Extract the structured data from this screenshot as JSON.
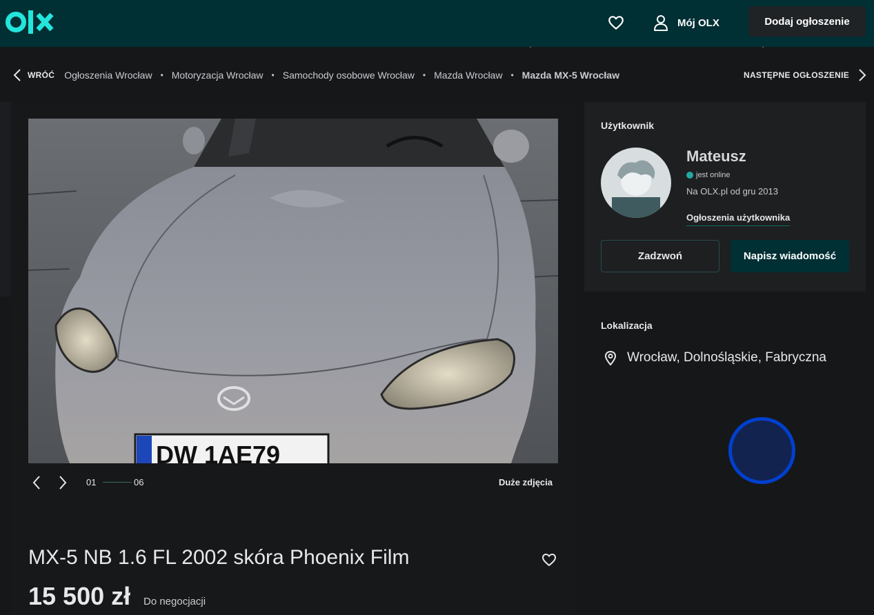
{
  "header": {
    "logo": "olx",
    "favorites_icon": "heart-icon",
    "account_icon": "user-icon",
    "account_label": "Mój OLX",
    "add_ad_label": "Dodaj ogłoszenie"
  },
  "breadcrumb": {
    "back_label": "WRÓĆ",
    "items": [
      "Ogłoszenia Wrocław",
      "Motoryzacja Wrocław",
      "Samochody osobowe Wrocław",
      "Mazda Wrocław",
      "Mazda MX-5 Wrocław"
    ],
    "separator": "•",
    "next_label": "NASTĘPNE OGŁOSZENIE"
  },
  "gallery": {
    "current": "01",
    "total": "06",
    "large_photos_label": "Duże zdjęcia",
    "plate_text": "DW 1AE79"
  },
  "ad": {
    "title": "MX-5 NB 1.6 FL 2002 skóra Phoenix Film",
    "price": "15 500 zł",
    "negotiable": "Do negocjacji"
  },
  "user": {
    "heading": "Użytkownik",
    "name": "Mateusz",
    "status": "jest online",
    "since": "Na OLX.pl od gru 2013",
    "ads_link": "Ogłoszenia użytkownika",
    "call_label": "Zadzwoń",
    "message_label": "Napisz wiadomość"
  },
  "location": {
    "heading": "Lokalizacja",
    "address": "Wrocław, Dolnośląskie, Fabryczna",
    "icon": "location-pin-icon"
  },
  "colors": {
    "topbar": "#002f34",
    "accent": "#23e5db",
    "background": "#161719",
    "map_spinner": "#0040ce"
  }
}
